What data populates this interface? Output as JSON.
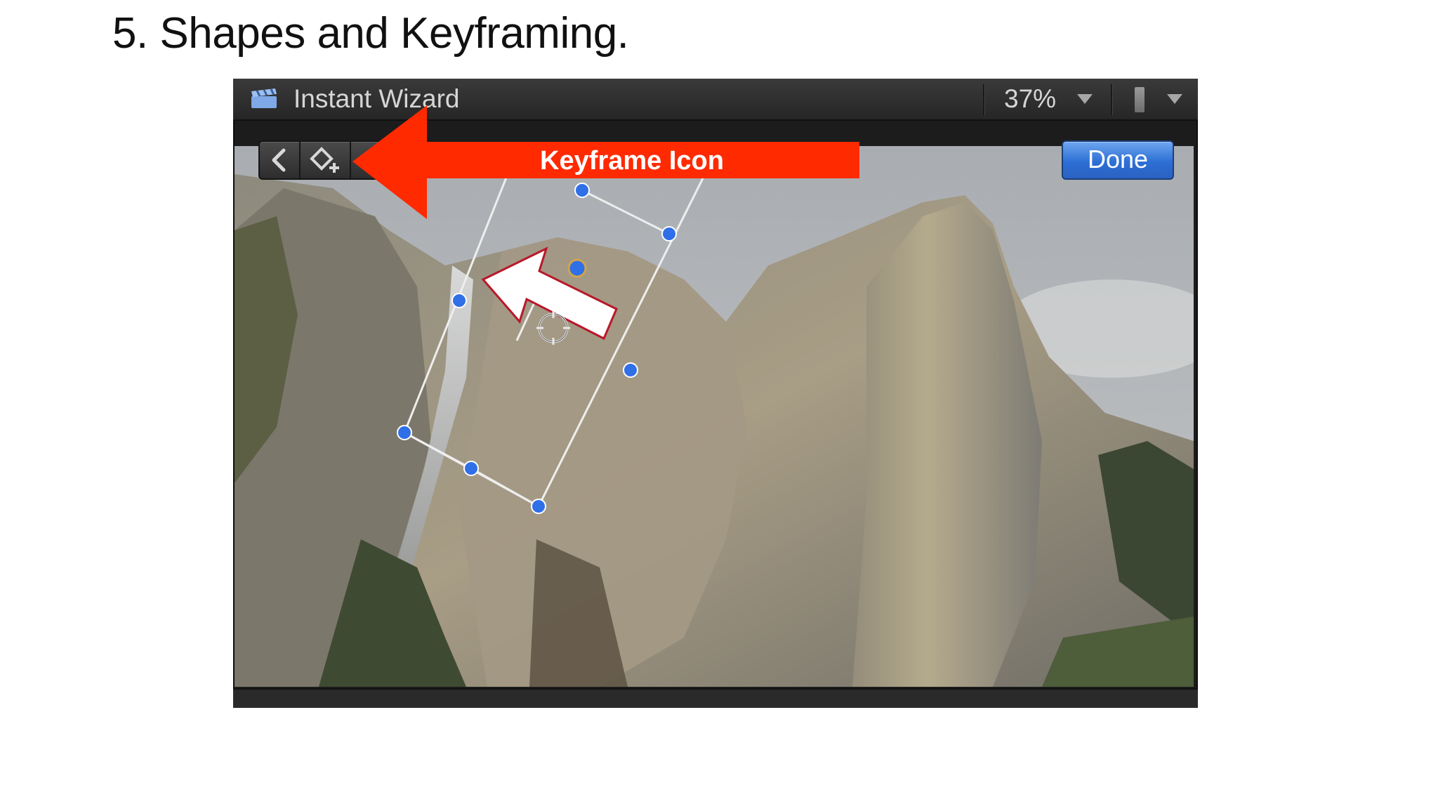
{
  "slide": {
    "title": "5. Shapes and Keyframing."
  },
  "viewer": {
    "title": "Instant Wizard",
    "zoom": "37%",
    "done_label": "Done",
    "icons": {
      "app": "clapperboard-icon",
      "zoom_menu": "chevron-down-icon",
      "view_options": "view-options-icon",
      "back": "chevron-left-icon",
      "keyframe": "add-keyframe-icon"
    }
  },
  "annotation": {
    "label": "Keyframe Icon",
    "color": "#ff2a00"
  },
  "colors": {
    "handle": "#2f6fe8",
    "done_button": "#2d6fd6",
    "panel": "#1c1c1c"
  }
}
